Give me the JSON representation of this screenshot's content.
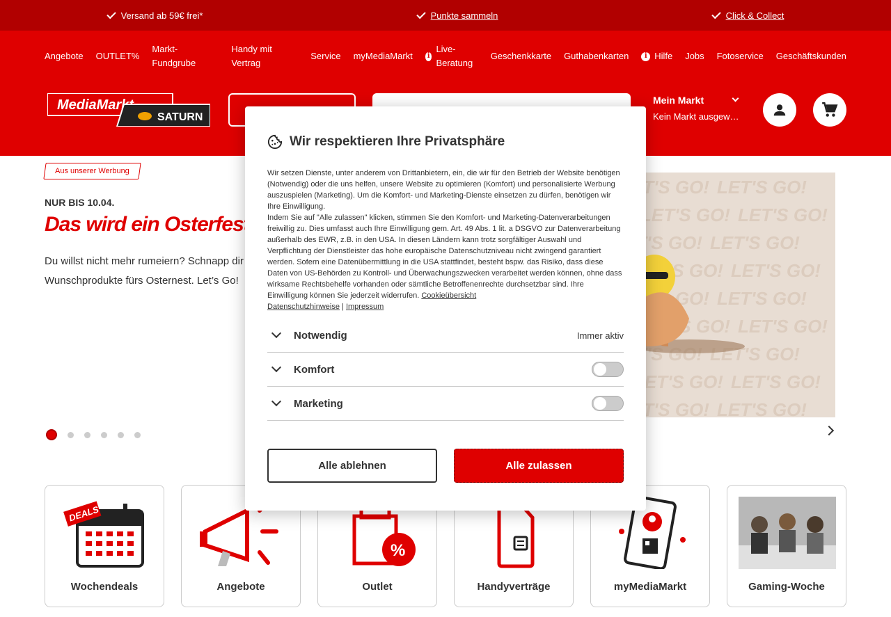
{
  "topbar": {
    "usps": [
      {
        "label": "Versand ab 59€ frei*",
        "link": false
      },
      {
        "label": "Punkte sammeln",
        "link": true
      },
      {
        "label": "Click & Collect",
        "link": true
      }
    ]
  },
  "nav": {
    "items": [
      "Angebote",
      "OUTLET%",
      "Markt-Fundgrube",
      "Handy mit Vertrag",
      "Service",
      "myMediaMarkt",
      "Live-Beratung",
      "Geschenkkarte",
      "Guthabenkarten",
      "Hilfe",
      "Jobs",
      "Fotoservice",
      "Geschäftskunden"
    ]
  },
  "header": {
    "logo_text_1": "MediaMarkt",
    "logo_text_2": "SATURN",
    "market_title": "Mein Markt",
    "market_sub": "Kein Markt ausgew…"
  },
  "hero": {
    "ad_tag": "Aus unserer Werbung",
    "date": "NUR BIS 10.04.",
    "title": "Das wird ein Osterfest!",
    "text": "Du willst nicht mehr rumeiern? Schnapp dir Wunschprodukte fürs Osternest. Let’s Go!",
    "image_text": "LET'S GO!",
    "slides": 6,
    "active_slide": 1
  },
  "tiles": [
    {
      "label": "Wochendeals",
      "icon": "calendar-deals-icon",
      "badge": "DEALS"
    },
    {
      "label": "Angebote",
      "icon": "megaphone-icon"
    },
    {
      "label": "Outlet",
      "icon": "outlet-percent-icon"
    },
    {
      "label": "Handyverträge",
      "icon": "phone-sim-icon"
    },
    {
      "label": "myMediaMarkt",
      "icon": "mymediamarkt-phone-icon"
    },
    {
      "label": "Gaming-Woche",
      "icon": "gaming-people-image"
    }
  ],
  "consent": {
    "title": "Wir respektieren Ihre Privatsphäre",
    "text1": "Wir setzen Dienste, unter anderem von Drittanbietern, ein, die wir für den Betrieb der Website benötigen (Notwendig) oder die uns helfen, unsere Website zu optimieren (Komfort) und personalisierte Werbung auszuspielen (Marketing). Um die Komfort- und Marketing-Dienste einsetzen zu dürfen, benötigen wir Ihre Einwilligung.",
    "text2": "Indem Sie auf \"Alle zulassen\" klicken, stimmen Sie den Komfort- und Marketing-Datenverarbeitungen freiwillig zu. Dies umfasst auch Ihre Einwilligung gem. Art. 49 Abs. 1 lit. a DSGVO zur Datenverarbeitung außerhalb des EWR, z.B. in den USA. In diesen Ländern kann trotz sorgfältiger Auswahl und Verpflichtung der Dienstleister das hohe europäische Datenschutzniveau nicht zwingend garantiert werden. Sofern eine Datenübermittlung in die USA stattfindet, besteht bspw. das Risiko, dass diese Daten von US-Behörden zu Kontroll- und Überwachungszwecken verarbeitet werden können, ohne dass wirksame Rechtsbehelfe vorhanden oder sämtliche Betroffenenrechte durchsetzbar sind. Ihre Einwilligung können Sie jederzeit widerrufen.",
    "link_cookies": "Cookieübersicht",
    "link_privacy": "Datenschutzhinweise",
    "separator": "|",
    "link_imprint": "Impressum",
    "categories": [
      {
        "name": "Notwendig",
        "status": "Immer aktiv"
      },
      {
        "name": "Komfort",
        "toggle": false
      },
      {
        "name": "Marketing",
        "toggle": false
      }
    ],
    "reject_label": "Alle ablehnen",
    "accept_label": "Alle zulassen"
  },
  "colors": {
    "brand_red": "#df0000",
    "dark_red": "#b10000"
  }
}
